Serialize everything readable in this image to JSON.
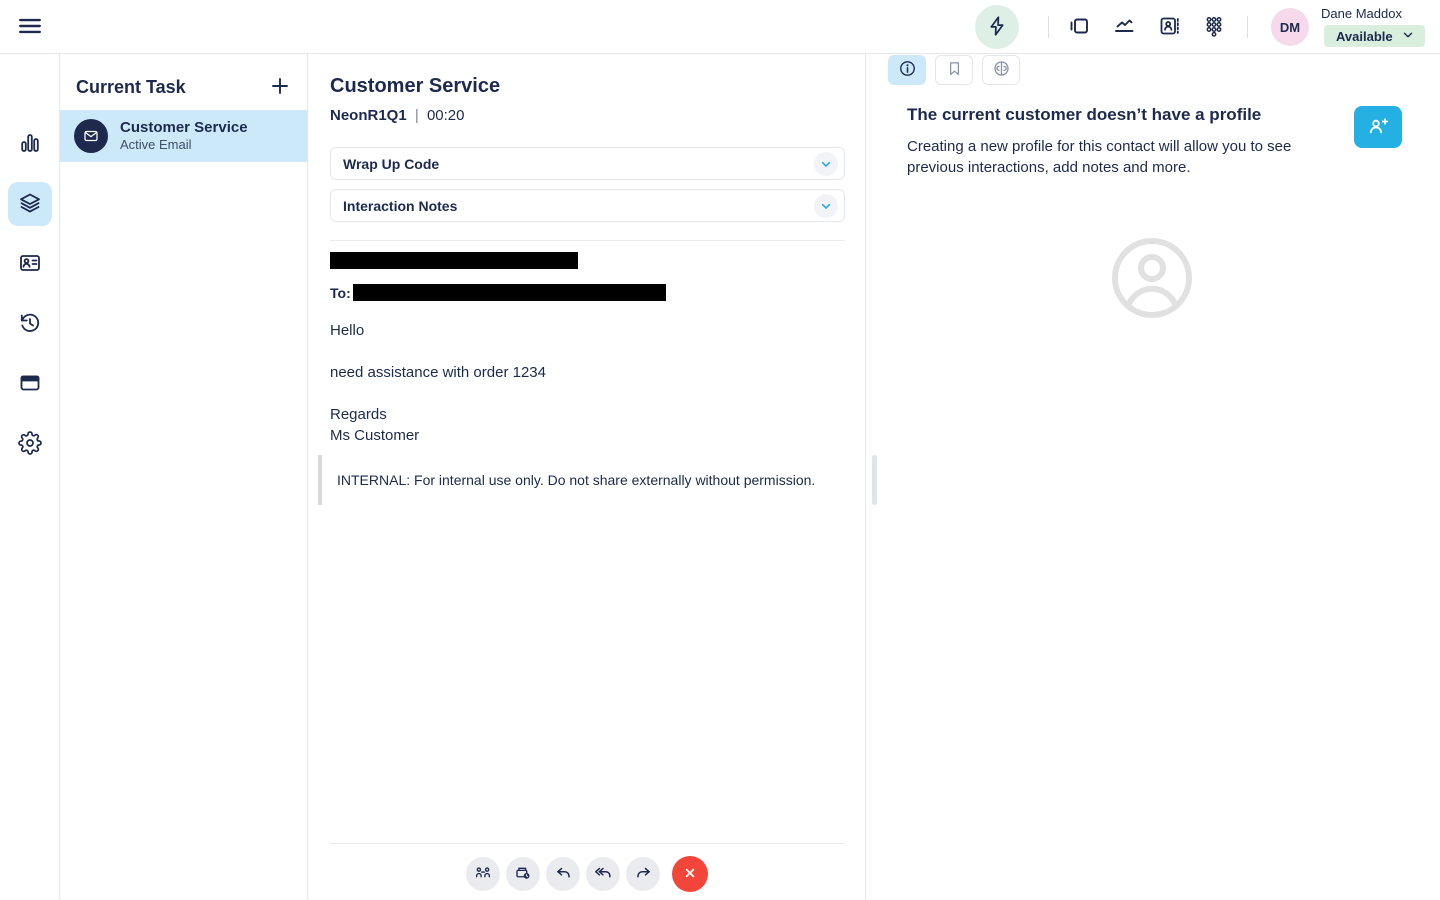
{
  "app": {
    "colors": {
      "navy": "#1d2a4d",
      "accent_cyan": "#29aede",
      "selected_blue": "#cbe9f8",
      "status_green_bg": "#d9eedd",
      "mint_bg": "#def0e6",
      "avatar_pink": "#f6d9ea",
      "danger_red": "#f4453a",
      "border": "#e4e7ec",
      "muted_gray": "#8a93a6"
    }
  },
  "header": {
    "icons": [
      "hamburger-icon",
      "lightning-icon",
      "panels-icon",
      "line-chart-icon",
      "directory-icon",
      "dialpad-icon"
    ],
    "user": {
      "initials": "DM",
      "name": "Dane Maddox",
      "status": "Available"
    }
  },
  "sidebar": {
    "icons": [
      "bar-chart-icon",
      "layers-icon",
      "contact-card-icon",
      "history-icon",
      "window-icon",
      "gear-icon"
    ],
    "selected_index": 1
  },
  "task_panel": {
    "title": "Current Task",
    "add_icon": "plus-icon",
    "items": [
      {
        "icon": "email-icon",
        "title": "Customer Service",
        "subtitle": "Active Email",
        "selected": true
      }
    ]
  },
  "main": {
    "title": "Customer Service",
    "queue": "NeonR1Q1",
    "divider": "|",
    "timer": "00:20",
    "accordions": [
      {
        "label": "Wrap Up Code",
        "icon": "chevron-down-icon"
      },
      {
        "label": "Interaction Notes",
        "icon": "chevron-down-icon"
      }
    ],
    "email": {
      "subject_redacted": true,
      "to_label": "To:",
      "to_redacted": true,
      "greeting": "Hello",
      "request": "need assistance with order 1234",
      "signoff": "Regards",
      "signature": "Ms Customer",
      "internal_note": "INTERNAL: For internal use only. Do not share externally without permission."
    },
    "toolbar": {
      "buttons": [
        "transfer-icon",
        "park-email-icon",
        "reply-icon",
        "reply-all-icon",
        "forward-icon",
        "disconnect-icon"
      ]
    }
  },
  "right_panel": {
    "tabs": [
      {
        "icon": "info-icon",
        "selected": true
      },
      {
        "icon": "bookmark-icon",
        "selected": false
      },
      {
        "icon": "brain-icon",
        "selected": false
      }
    ],
    "empty_profile": {
      "title": "The current customer doesn’t have a profile",
      "description": "Creating a new profile for this contact will allow you to see previous interactions, add notes and more.",
      "add_button_icon": "person-plus-icon",
      "placeholder_icon": "person-placeholder-icon"
    }
  }
}
